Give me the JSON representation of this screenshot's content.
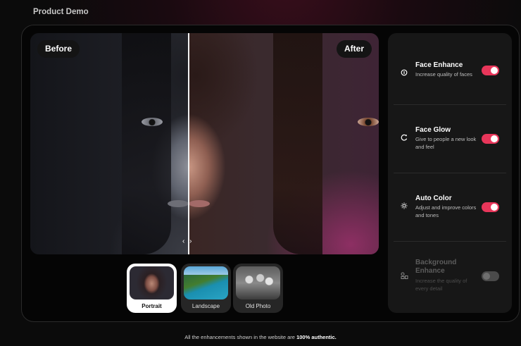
{
  "section_title": "Product Demo",
  "viewer": {
    "before_label": "Before",
    "after_label": "After",
    "handle_glyph": "‹ ›",
    "split_fraction": 0.455
  },
  "thumbnails": [
    {
      "label": "Portrait",
      "active": true
    },
    {
      "label": "Landscape",
      "active": false
    },
    {
      "label": "Old Photo",
      "active": false
    }
  ],
  "features": [
    {
      "title": "Face Enhance",
      "desc": "Increase quality of faces",
      "icon": "face-icon",
      "enabled": true,
      "disabled": false
    },
    {
      "title": "Face Glow",
      "desc": "Give to people a new look and feel",
      "icon": "glow-icon",
      "enabled": true,
      "disabled": false
    },
    {
      "title": "Auto Color",
      "desc": "Adjust and improve colors and tones",
      "icon": "sun-icon",
      "enabled": true,
      "disabled": false
    },
    {
      "title": "Background Enhance",
      "desc": "Increase the quality of every detail",
      "icon": "background-icon",
      "enabled": false,
      "disabled": true
    }
  ],
  "footer": {
    "prefix": "All the enhancements shown in the website are",
    "emphasis": "100% authentic."
  },
  "colors": {
    "accent": "#e8365a",
    "panel": "#171717",
    "background": "#0b0b0b"
  }
}
